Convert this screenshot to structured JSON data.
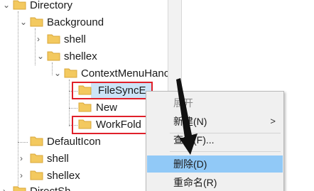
{
  "tree": {
    "nodes": [
      {
        "id": "directory",
        "label": "Directory",
        "expand": "collapse"
      },
      {
        "id": "background",
        "label": "Background",
        "expand": "collapse"
      },
      {
        "id": "shell-bg",
        "label": "shell",
        "expand": "expand"
      },
      {
        "id": "shellex-bg",
        "label": "shellex",
        "expand": "collapse"
      },
      {
        "id": "contextmenuhandlers",
        "label": "ContextMenuHanc",
        "expand": "collapse"
      },
      {
        "id": "filesynce",
        "label": "FileSyncE",
        "expand": "none",
        "selected": true
      },
      {
        "id": "new",
        "label": "New",
        "expand": "none"
      },
      {
        "id": "workfold",
        "label": "WorkFold",
        "expand": "none"
      },
      {
        "id": "defaulticon",
        "label": "DefaultIcon",
        "expand": "none"
      },
      {
        "id": "shell-dir",
        "label": "shell",
        "expand": "expand"
      },
      {
        "id": "shellex-dir",
        "label": "shellex",
        "expand": "expand"
      },
      {
        "id": "directshow",
        "label": "DirectSh",
        "expand": "expand"
      }
    ]
  },
  "context_menu": {
    "items": [
      {
        "label": "展开",
        "state": "disabled"
      },
      {
        "label": "新建(N)",
        "state": "normal",
        "submenu": true
      },
      {
        "label": "查找(F)...",
        "state": "normal"
      },
      {
        "label": "删除(D)",
        "state": "highlighted"
      },
      {
        "label": "重命名(R)",
        "state": "normal"
      }
    ],
    "submenu_arrow": ">"
  },
  "icons": {
    "expand": "›",
    "collapse": "⌄"
  },
  "colors": {
    "folder": "#f3c95f",
    "folder_edge": "#d9a73a",
    "selection": "#cce4f7",
    "menu_hot": "#91c9f7",
    "highlight_box": "#e0202a",
    "annotation_arrow": "#111111"
  }
}
